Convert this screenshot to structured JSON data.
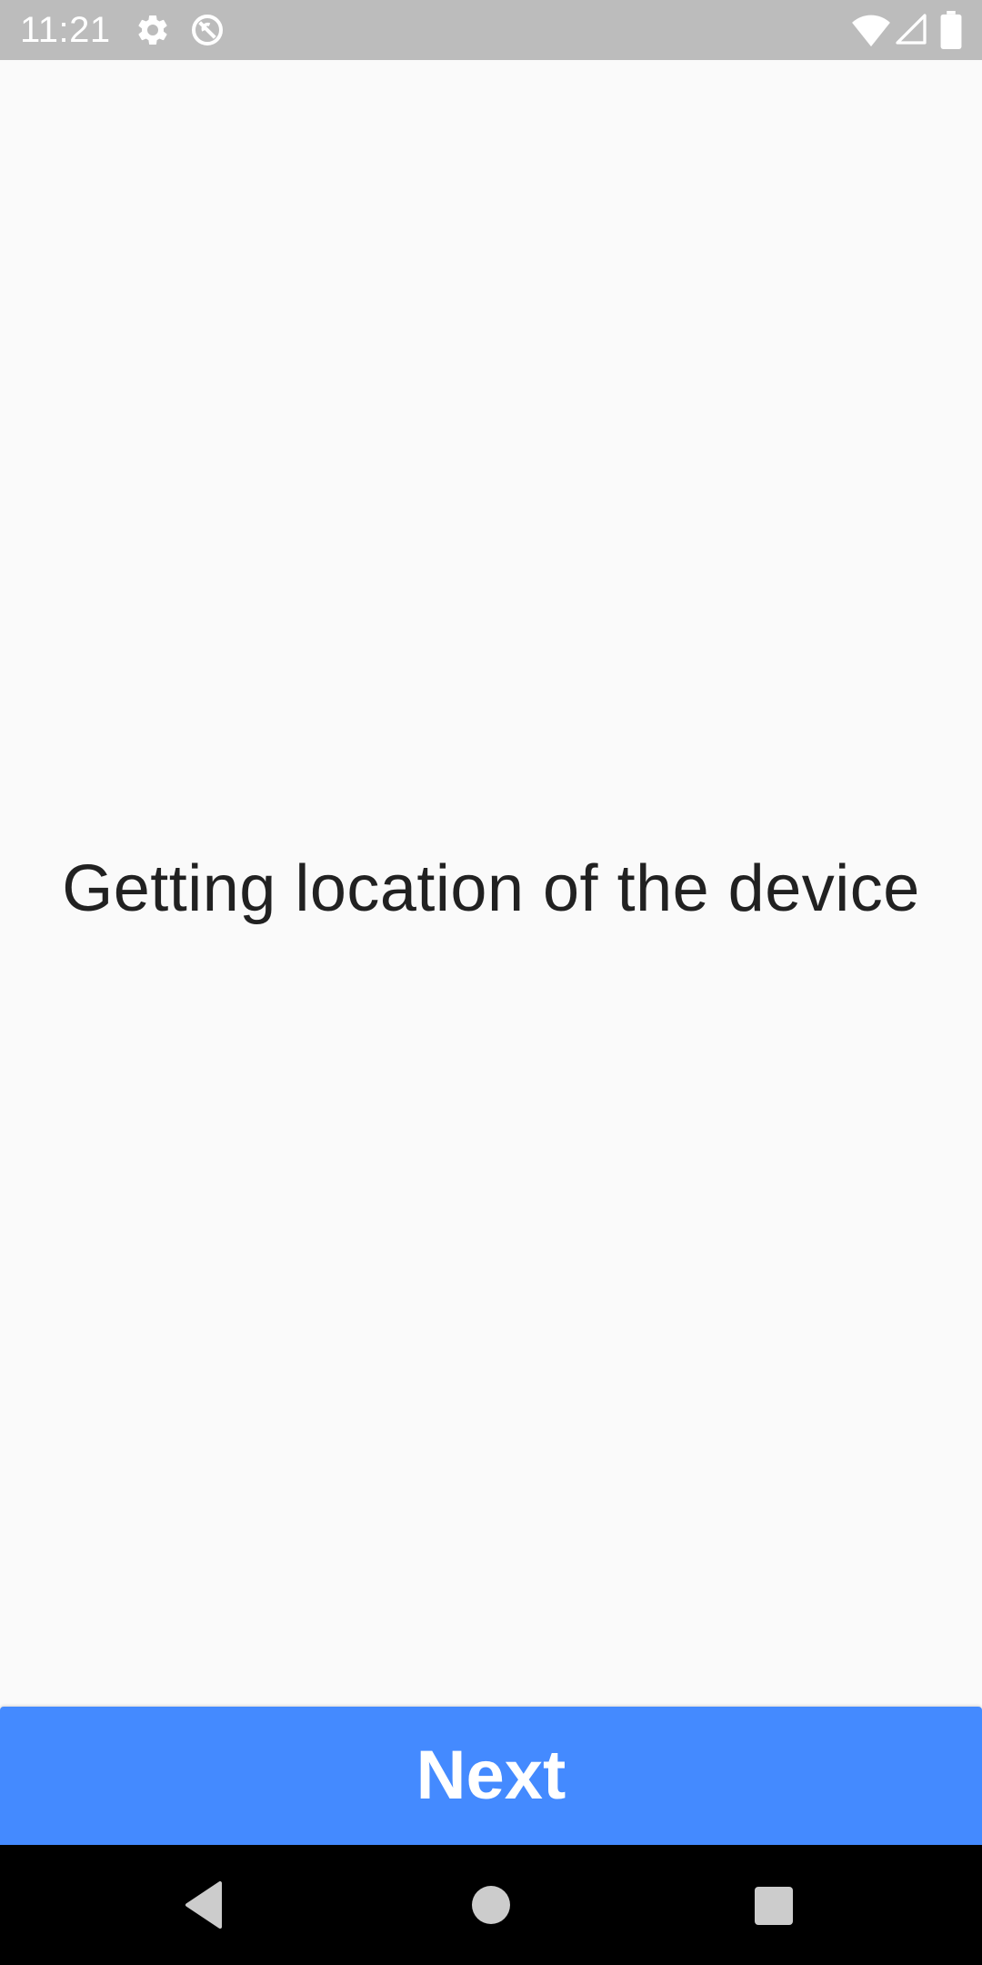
{
  "status_bar": {
    "time": "11:21",
    "icons": [
      "settings-icon",
      "do-not-disturb-icon",
      "wifi-icon",
      "signal-icon",
      "battery-icon"
    ],
    "background": "#bcbcbc"
  },
  "main": {
    "message": "Getting location of the device",
    "text_color": "#212121"
  },
  "action": {
    "next_label": "Next",
    "color": "#448aff"
  },
  "nav_bar": {
    "buttons": [
      "back-icon",
      "home-icon",
      "recents-icon"
    ]
  }
}
